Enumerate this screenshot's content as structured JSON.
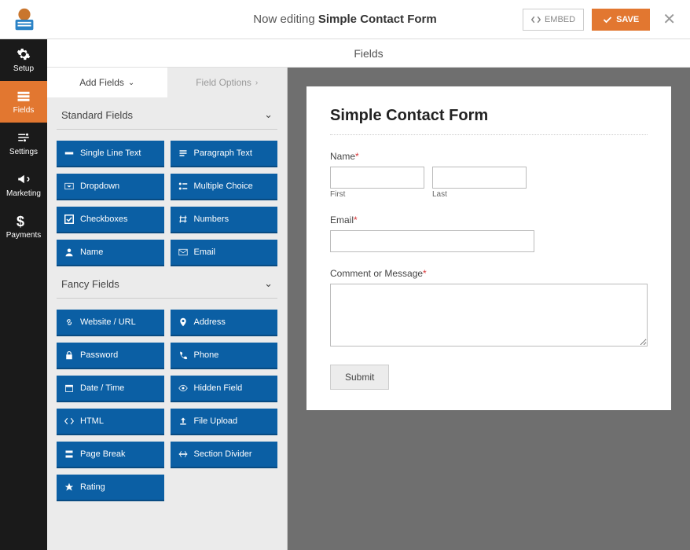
{
  "topbar": {
    "editing_prefix": "Now editing ",
    "form_name": "Simple Contact Form",
    "embed_label": "EMBED",
    "save_label": "SAVE"
  },
  "leftnav": {
    "setup": "Setup",
    "fields": "Fields",
    "settings": "Settings",
    "marketing": "Marketing",
    "payments": "Payments"
  },
  "fields_header": "Fields",
  "tabs": {
    "add_fields": "Add Fields",
    "field_options": "Field Options"
  },
  "groups": {
    "standard": {
      "title": "Standard Fields",
      "items": [
        "Single Line Text",
        "Paragraph Text",
        "Dropdown",
        "Multiple Choice",
        "Checkboxes",
        "Numbers",
        "Name",
        "Email"
      ]
    },
    "fancy": {
      "title": "Fancy Fields",
      "items": [
        "Website / URL",
        "Address",
        "Password",
        "Phone",
        "Date / Time",
        "Hidden Field",
        "HTML",
        "File Upload",
        "Page Break",
        "Section Divider",
        "Rating"
      ]
    }
  },
  "form": {
    "title": "Simple Contact Form",
    "name_label": "Name",
    "first_label": "First",
    "last_label": "Last",
    "email_label": "Email",
    "comment_label": "Comment or Message",
    "submit_label": "Submit"
  }
}
